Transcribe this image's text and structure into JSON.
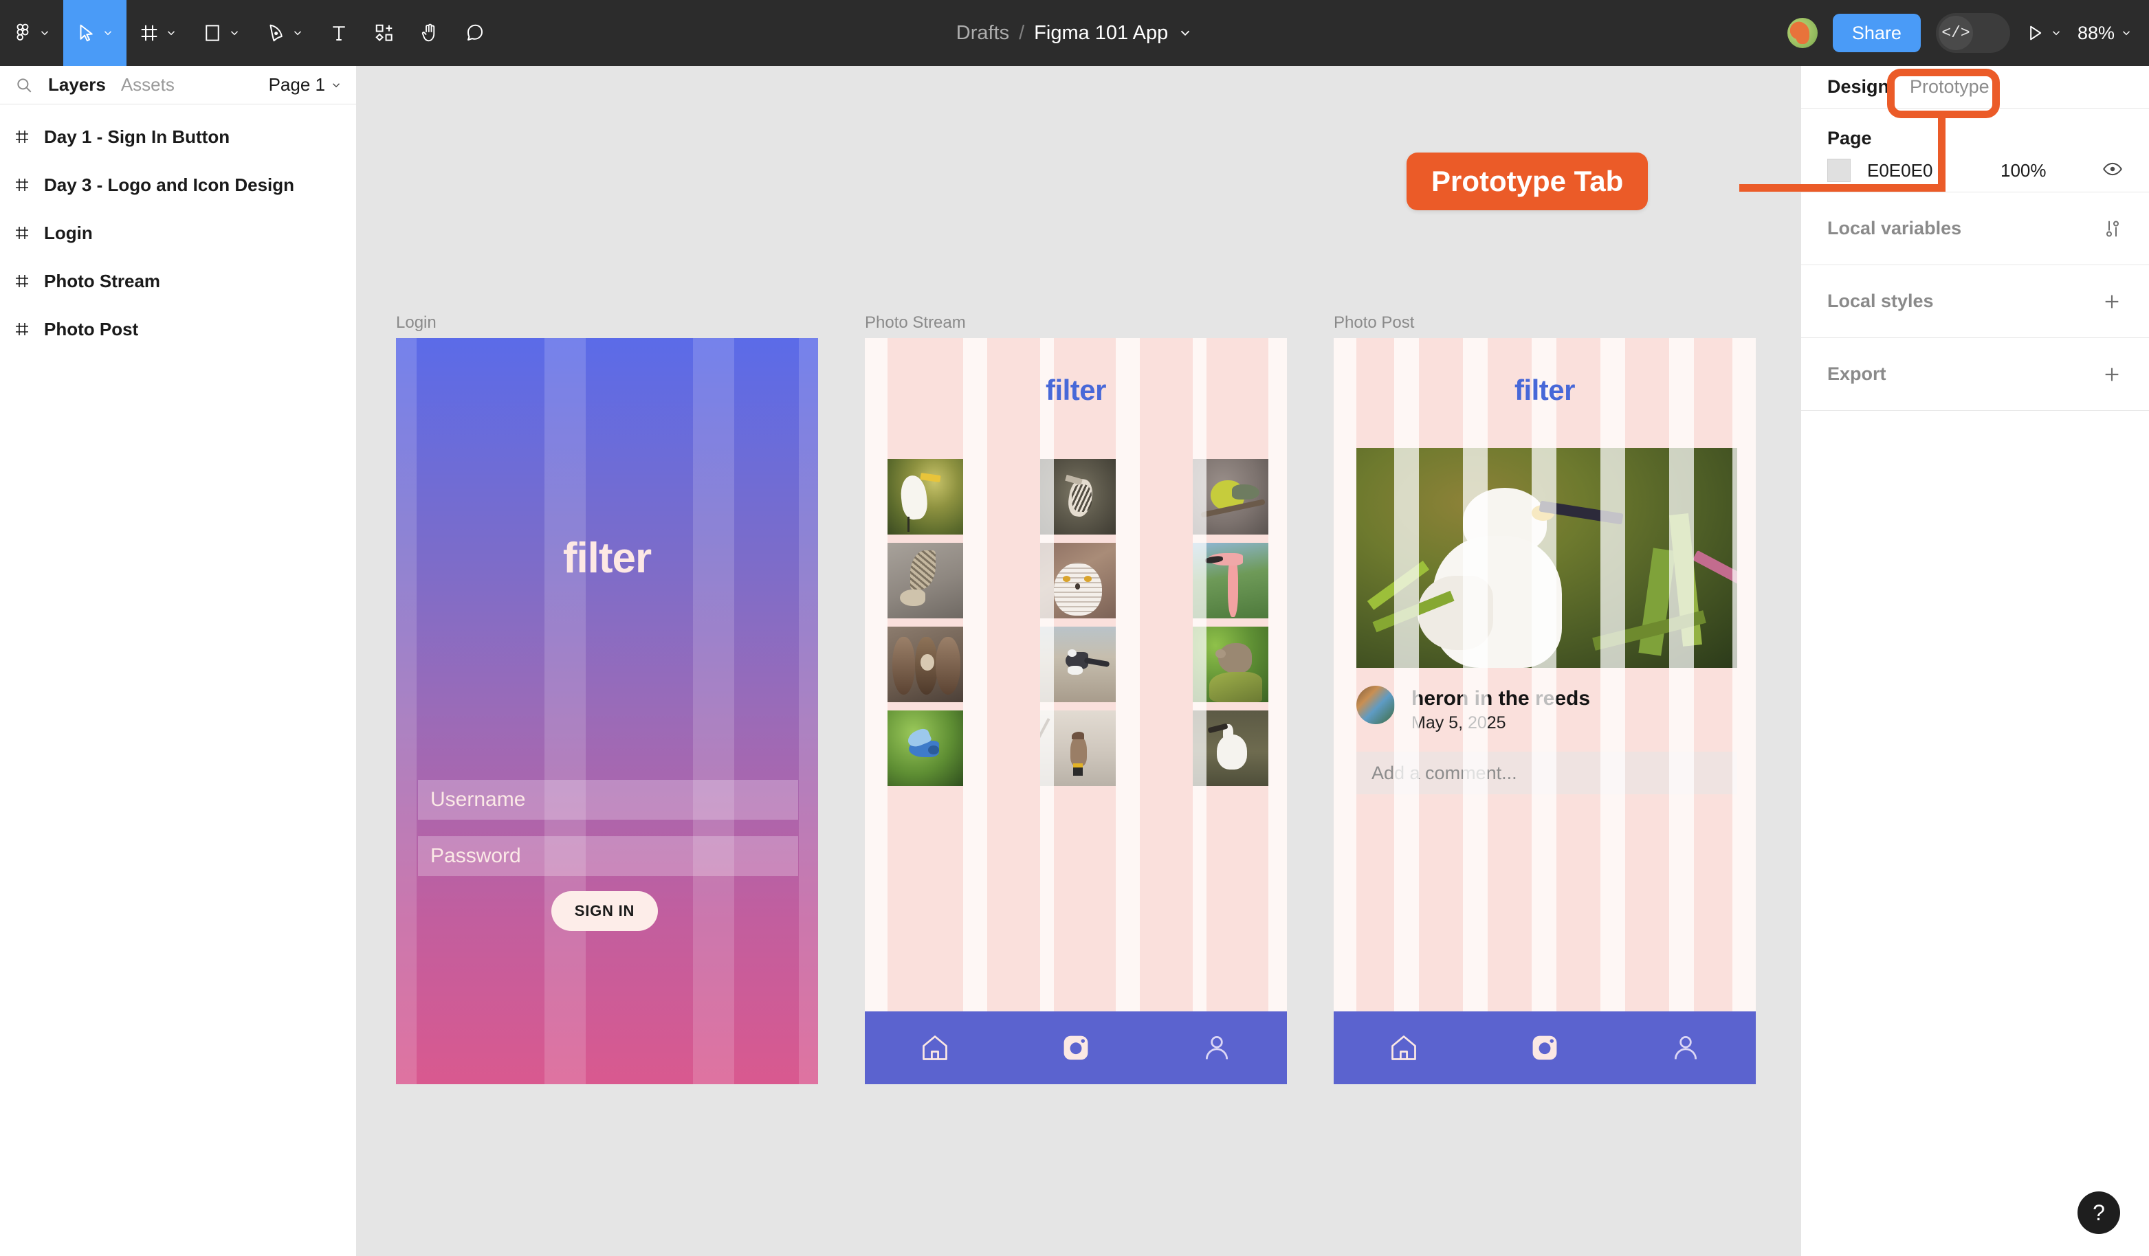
{
  "toolbar": {
    "tools": [
      {
        "name": "figma-menu-icon",
        "has_caret": true
      },
      {
        "name": "move-tool-icon",
        "has_caret": true,
        "active": true
      },
      {
        "name": "frame-tool-icon",
        "has_caret": true
      },
      {
        "name": "shape-tool-icon",
        "has_caret": true
      },
      {
        "name": "pen-tool-icon",
        "has_caret": true
      },
      {
        "name": "text-tool-icon",
        "has_caret": false
      },
      {
        "name": "actions-tool-icon",
        "has_caret": false
      },
      {
        "name": "hand-tool-icon",
        "has_caret": false
      },
      {
        "name": "comment-tool-icon",
        "has_caret": false
      }
    ],
    "breadcrumb_parent": "Drafts",
    "breadcrumb_separator": "/",
    "breadcrumb_file": "Figma 101 App",
    "share_label": "Share",
    "devmode_glyph": "</>",
    "zoom_level": "88%"
  },
  "left_panel": {
    "tab_layers": "Layers",
    "tab_assets": "Assets",
    "page_selector": "Page 1",
    "layers": [
      {
        "label": "Day 1 - Sign In Button"
      },
      {
        "label": "Day 3 - Logo and Icon Design"
      },
      {
        "label": "Login"
      },
      {
        "label": "Photo Stream"
      },
      {
        "label": "Photo Post"
      }
    ]
  },
  "canvas": {
    "frames": [
      {
        "label": "Login"
      },
      {
        "label": "Photo Stream"
      },
      {
        "label": "Photo Post"
      }
    ],
    "login_frame": {
      "logo": "filter",
      "username_placeholder": "Username",
      "password_placeholder": "Password",
      "signin_label": "SIGN IN"
    },
    "photo_stream_frame": {
      "logo": "filter",
      "nav_items": [
        "home-icon",
        "camera-icon",
        "profile-icon"
      ],
      "photos": [
        "white-egret-in-grass",
        "kingfisher-on-post",
        "yellow-warbler-on-branch",
        "owl-in-flight",
        "snowy-owl-face",
        "flamingo-head",
        "sparrow-in-coconut-feeder",
        "wagtail-on-gravel",
        "sparrow-on-mossy-rock",
        "bluebird-in-flight",
        "waxwing-on-wire",
        "egret-in-water"
      ]
    },
    "photo_post_frame": {
      "logo": "filter",
      "hero_photo": "snowy-egret-in-reeds",
      "post_title": "heron in the reeds",
      "post_date": "May 5, 2025",
      "comment_placeholder": "Add a comment...",
      "nav_items": [
        "home-icon",
        "camera-icon",
        "profile-icon"
      ]
    }
  },
  "callout": {
    "text": "Prototype Tab",
    "color": "#EB5B28"
  },
  "right_panel": {
    "tab_design": "Design",
    "tab_prototype": "Prototype",
    "page_section_title": "Page",
    "page_color_hex": "E0E0E0",
    "page_color_opacity": "100%",
    "sections": [
      {
        "label": "Local variables",
        "action": "variables-icon"
      },
      {
        "label": "Local styles",
        "action": "plus-icon"
      },
      {
        "label": "Export",
        "action": "plus-icon"
      }
    ]
  },
  "help": {
    "glyph": "?"
  }
}
